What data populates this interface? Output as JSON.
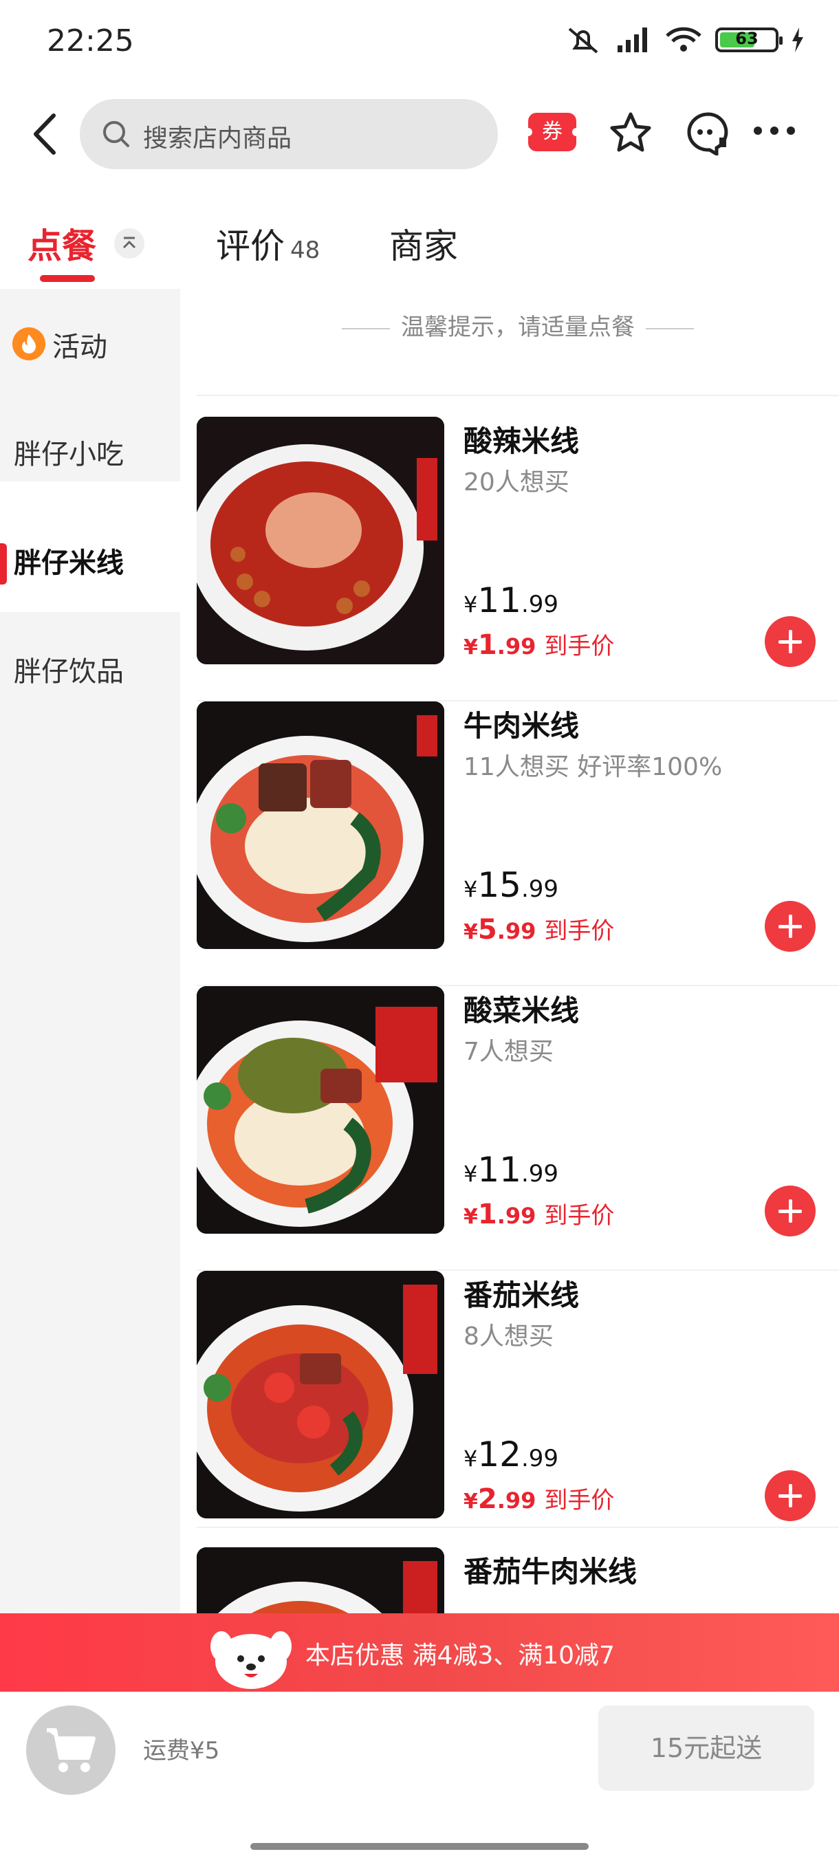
{
  "status_bar": {
    "time": "22:25",
    "battery": "63"
  },
  "search": {
    "placeholder": "搜索店内商品"
  },
  "nav": {
    "coupon_label": "券"
  },
  "tabs": {
    "order": "点餐",
    "reviews": "评价",
    "reviews_count": "48",
    "merchant": "商家"
  },
  "sidebar": {
    "items": [
      {
        "label": "活动"
      },
      {
        "label": "胖仔小吃"
      },
      {
        "label": "胖仔米线"
      },
      {
        "label": "胖仔饮品"
      }
    ]
  },
  "hint": "温馨提示，请适量点餐",
  "products": [
    {
      "name": "酸辣米线",
      "sub": "20人想买",
      "price_int": "11",
      "price_dec": ".99",
      "deal_int": "1",
      "deal_dec": ".99",
      "deal_tag": "到手价"
    },
    {
      "name": "牛肉米线",
      "sub": "11人想买 好评率100%",
      "price_int": "15",
      "price_dec": ".99",
      "deal_int": "5",
      "deal_dec": ".99",
      "deal_tag": "到手价"
    },
    {
      "name": "酸菜米线",
      "sub": "7人想买",
      "price_int": "11",
      "price_dec": ".99",
      "deal_int": "1",
      "deal_dec": ".99",
      "deal_tag": "到手价"
    },
    {
      "name": "番茄米线",
      "sub": "8人想买",
      "price_int": "12",
      "price_dec": ".99",
      "deal_int": "2",
      "deal_dec": ".99",
      "deal_tag": "到手价"
    },
    {
      "name": "番茄牛肉米线"
    }
  ],
  "currency": "¥",
  "promo": {
    "text": "本店优惠  满4减3、满10减7"
  },
  "cart": {
    "fee": "运费¥5",
    "checkout": "15元起送"
  },
  "colors": {
    "accent": "#e8242f",
    "promo": "#ff3a48",
    "sidebar_bg": "#f4f4f4"
  }
}
